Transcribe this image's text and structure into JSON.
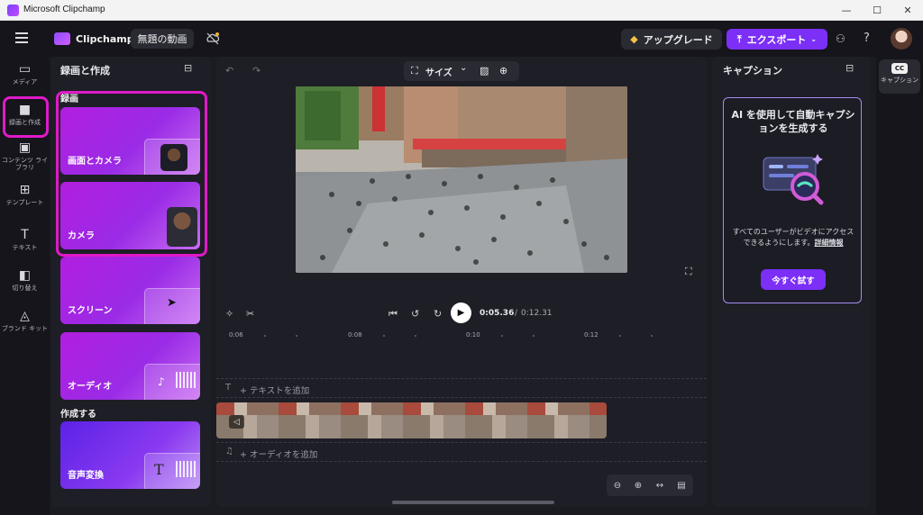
{
  "window": {
    "title": "Microsoft Clipchamp",
    "controls": [
      "—",
      "☐",
      "✕"
    ]
  },
  "topbar": {
    "app_name": "Clipchamp",
    "project_name": "無題の動画",
    "upgrade_label": "アップグレード",
    "export_label": "エクスポート",
    "accent": "#7b2ff7"
  },
  "rail": {
    "items": [
      {
        "label": "メディア",
        "icon": "folder-icon"
      },
      {
        "label": "録画と作成",
        "icon": "video-camera-icon"
      },
      {
        "label": "コンテンツ ライブラリ",
        "icon": "library-icon"
      },
      {
        "label": "テンプレート",
        "icon": "templates-icon"
      },
      {
        "label": "テキスト",
        "icon": "text-icon"
      },
      {
        "label": "切り替え",
        "icon": "transitions-icon"
      },
      {
        "label": "ブランド キット",
        "icon": "brand-kit-icon"
      }
    ]
  },
  "leftpanel": {
    "title": "録画と作成",
    "section_record": "録画",
    "section_create": "作成する",
    "cards": [
      {
        "label": "画面とカメラ"
      },
      {
        "label": "カメラ"
      },
      {
        "label": "スクリーン"
      },
      {
        "label": "オーディオ"
      },
      {
        "label": "音声変換"
      }
    ],
    "highlight_color": "#e019c8"
  },
  "center": {
    "size_label": "サイズ",
    "time_current": "0:05.36",
    "time_separator": "/",
    "time_total": "0:12.31",
    "ticks": [
      "0:06",
      "0:08",
      "0:10",
      "0:12"
    ],
    "add_text": "+ テキストを追加",
    "add_audio": "+ オーディオを追加",
    "text_track_icon": "T"
  },
  "rightpanel": {
    "title": "キャプション",
    "card_title": "AI を使用して自動キャプションを生成する",
    "card_desc": "すべてのユーザーがビデオにアクセスできるようにします。",
    "card_link": "詳細情報",
    "try_button": "今すぐ試す"
  },
  "farright": {
    "badge": "CC",
    "label": "キャプション"
  }
}
